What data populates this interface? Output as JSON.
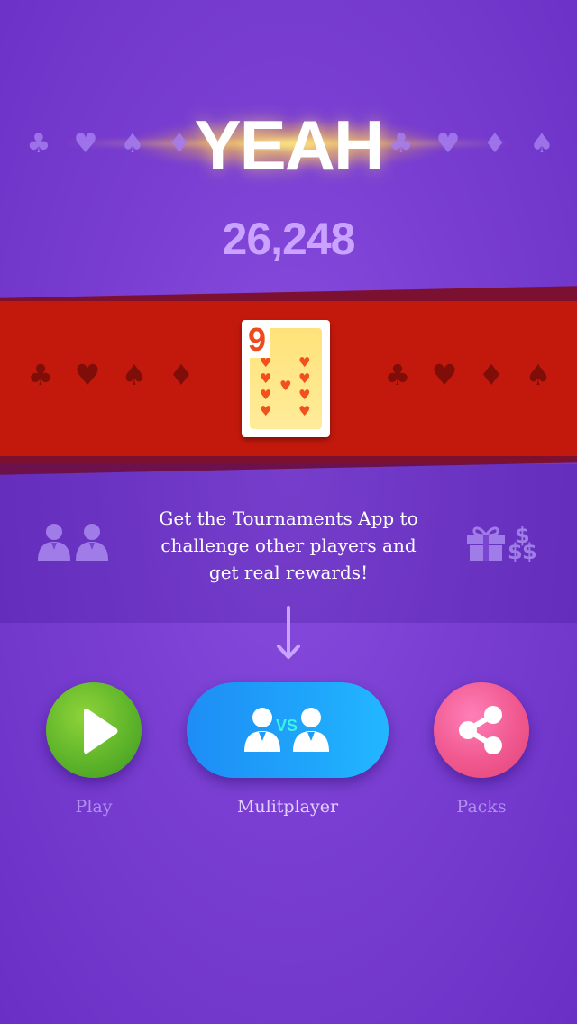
{
  "header": {
    "title": "YEAH",
    "score": "26,248",
    "suits_left": [
      "♣",
      "♥",
      "♠",
      "♦"
    ],
    "suits_right": [
      "♣",
      "♥",
      "♦",
      "♠"
    ]
  },
  "ribbon": {
    "suits_left": [
      "♣",
      "♥",
      "♠",
      "♦"
    ],
    "suits_right": [
      "♣",
      "♥",
      "♦",
      "♠"
    ],
    "card": {
      "rank": "9",
      "suit": "♥",
      "suit_name": "hearts"
    }
  },
  "promo": {
    "line1": "Get the Tournaments App to",
    "line2": "challenge other players and",
    "line3": "get real rewards!",
    "dollar_sign": "$"
  },
  "buttons": {
    "play_label": "Play",
    "multiplayer_label": "Mulitplayer",
    "multiplayer_vs": "VS",
    "packs_label": "Packs"
  },
  "colors": {
    "background": "#7a3fd2",
    "ribbon": "#c3190d",
    "play": "#5fb52a",
    "multiplayer": "#1fa5fb",
    "packs": "#f0588f"
  }
}
